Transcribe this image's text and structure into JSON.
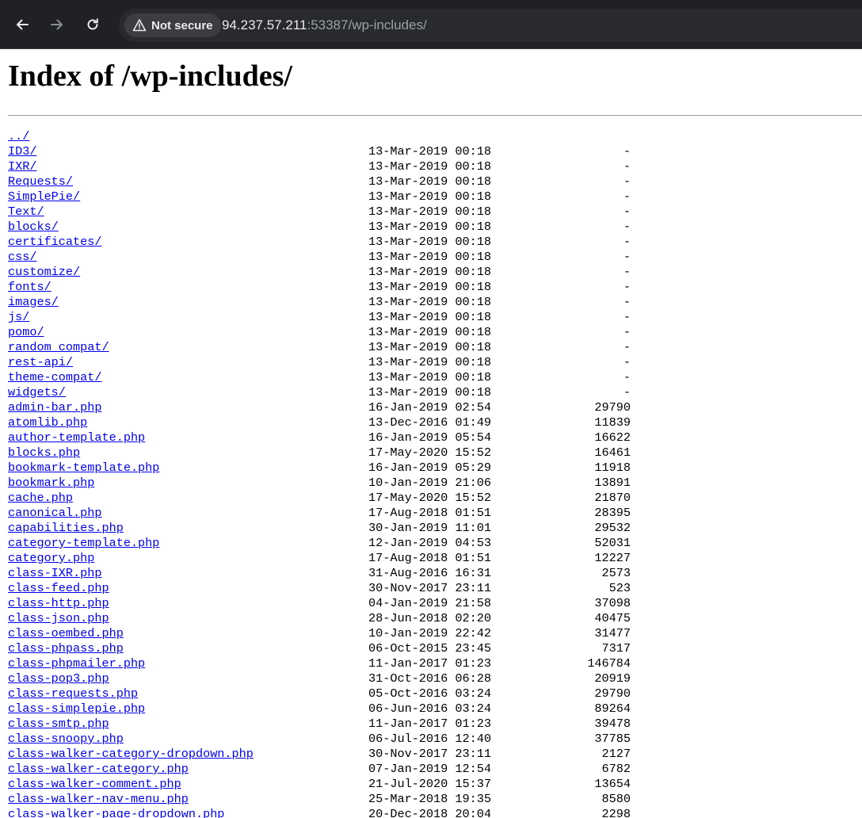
{
  "browser": {
    "security_label": "Not secure",
    "url_host": "94.237.57.211",
    "url_rest": ":53387/wp-includes/",
    "icons": [
      "back-arrow-icon",
      "forward-arrow-icon",
      "reload-icon",
      "warning-triangle-icon"
    ]
  },
  "page": {
    "title": "Index of /wp-includes/"
  },
  "listing": {
    "parent": "../",
    "entries": [
      {
        "name": "ID3/",
        "date": "13-Mar-2019 00:18",
        "size": "-"
      },
      {
        "name": "IXR/",
        "date": "13-Mar-2019 00:18",
        "size": "-"
      },
      {
        "name": "Requests/",
        "date": "13-Mar-2019 00:18",
        "size": "-"
      },
      {
        "name": "SimplePie/",
        "date": "13-Mar-2019 00:18",
        "size": "-"
      },
      {
        "name": "Text/",
        "date": "13-Mar-2019 00:18",
        "size": "-"
      },
      {
        "name": "blocks/",
        "date": "13-Mar-2019 00:18",
        "size": "-"
      },
      {
        "name": "certificates/",
        "date": "13-Mar-2019 00:18",
        "size": "-"
      },
      {
        "name": "css/",
        "date": "13-Mar-2019 00:18",
        "size": "-"
      },
      {
        "name": "customize/",
        "date": "13-Mar-2019 00:18",
        "size": "-"
      },
      {
        "name": "fonts/",
        "date": "13-Mar-2019 00:18",
        "size": "-"
      },
      {
        "name": "images/",
        "date": "13-Mar-2019 00:18",
        "size": "-"
      },
      {
        "name": "js/",
        "date": "13-Mar-2019 00:18",
        "size": "-"
      },
      {
        "name": "pomo/",
        "date": "13-Mar-2019 00:18",
        "size": "-"
      },
      {
        "name": "random_compat/",
        "date": "13-Mar-2019 00:18",
        "size": "-"
      },
      {
        "name": "rest-api/",
        "date": "13-Mar-2019 00:18",
        "size": "-"
      },
      {
        "name": "theme-compat/",
        "date": "13-Mar-2019 00:18",
        "size": "-"
      },
      {
        "name": "widgets/",
        "date": "13-Mar-2019 00:18",
        "size": "-"
      },
      {
        "name": "admin-bar.php",
        "date": "16-Jan-2019 02:54",
        "size": "29790"
      },
      {
        "name": "atomlib.php",
        "date": "13-Dec-2016 01:49",
        "size": "11839"
      },
      {
        "name": "author-template.php",
        "date": "16-Jan-2019 05:54",
        "size": "16622"
      },
      {
        "name": "blocks.php",
        "date": "17-May-2020 15:52",
        "size": "16461"
      },
      {
        "name": "bookmark-template.php",
        "date": "16-Jan-2019 05:29",
        "size": "11918"
      },
      {
        "name": "bookmark.php",
        "date": "10-Jan-2019 21:06",
        "size": "13891"
      },
      {
        "name": "cache.php",
        "date": "17-May-2020 15:52",
        "size": "21870"
      },
      {
        "name": "canonical.php",
        "date": "17-Aug-2018 01:51",
        "size": "28395"
      },
      {
        "name": "capabilities.php",
        "date": "30-Jan-2019 11:01",
        "size": "29532"
      },
      {
        "name": "category-template.php",
        "date": "12-Jan-2019 04:53",
        "size": "52031"
      },
      {
        "name": "category.php",
        "date": "17-Aug-2018 01:51",
        "size": "12227"
      },
      {
        "name": "class-IXR.php",
        "date": "31-Aug-2016 16:31",
        "size": "2573"
      },
      {
        "name": "class-feed.php",
        "date": "30-Nov-2017 23:11",
        "size": "523"
      },
      {
        "name": "class-http.php",
        "date": "04-Jan-2019 21:58",
        "size": "37098"
      },
      {
        "name": "class-json.php",
        "date": "28-Jun-2018 02:20",
        "size": "40475"
      },
      {
        "name": "class-oembed.php",
        "date": "10-Jan-2019 22:42",
        "size": "31477"
      },
      {
        "name": "class-phpass.php",
        "date": "06-Oct-2015 23:45",
        "size": "7317"
      },
      {
        "name": "class-phpmailer.php",
        "date": "11-Jan-2017 01:23",
        "size": "146784"
      },
      {
        "name": "class-pop3.php",
        "date": "31-Oct-2016 06:28",
        "size": "20919"
      },
      {
        "name": "class-requests.php",
        "date": "05-Oct-2016 03:24",
        "size": "29790"
      },
      {
        "name": "class-simplepie.php",
        "date": "06-Jun-2016 03:24",
        "size": "89264"
      },
      {
        "name": "class-smtp.php",
        "date": "11-Jan-2017 01:23",
        "size": "39478"
      },
      {
        "name": "class-snoopy.php",
        "date": "06-Jul-2016 12:40",
        "size": "37785"
      },
      {
        "name": "class-walker-category-dropdown.php",
        "date": "30-Nov-2017 23:11",
        "size": "2127"
      },
      {
        "name": "class-walker-category.php",
        "date": "07-Jan-2019 12:54",
        "size": "6782"
      },
      {
        "name": "class-walker-comment.php",
        "date": "21-Jul-2020 15:37",
        "size": "13654"
      },
      {
        "name": "class-walker-nav-menu.php",
        "date": "25-Mar-2018 19:35",
        "size": "8580"
      },
      {
        "name": "class-walker-page-dropdown.php",
        "date": "20-Dec-2018 20:04",
        "size": "2298"
      }
    ]
  }
}
